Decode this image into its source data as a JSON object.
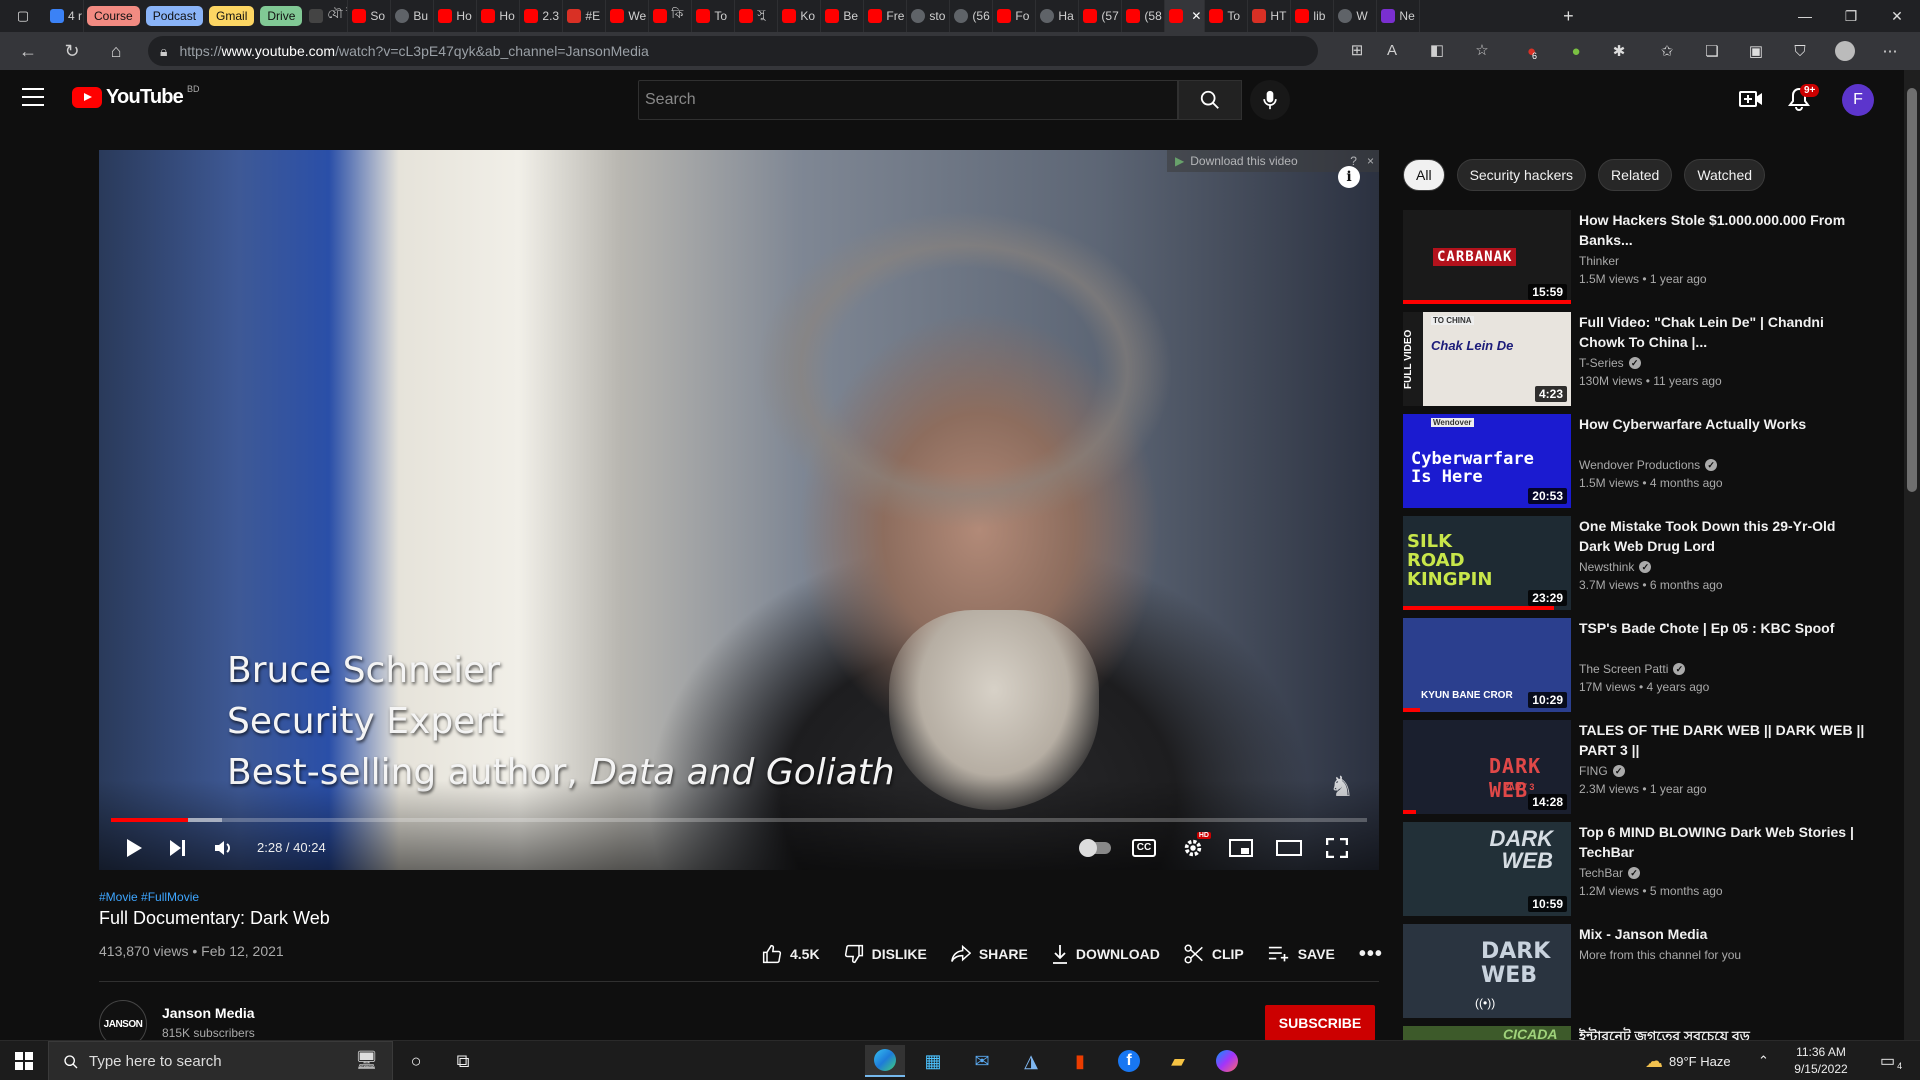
{
  "browser": {
    "tab_groups": [
      {
        "label": "Course",
        "color": "#f28b82"
      },
      {
        "label": "Podcast",
        "color": "#8ab4f8"
      },
      {
        "label": "Gmail",
        "color": "#fdd663"
      },
      {
        "label": "Drive",
        "color": "#81c995"
      }
    ],
    "tabs_before": [
      "4 r"
    ],
    "tabs_after": [
      "যৌ ট",
      "So",
      "Bu",
      "Ho",
      "Ho",
      "2.3",
      "#E",
      "We",
      "কি",
      "To",
      "সু",
      "Ko",
      "Be",
      "Fre",
      "sto",
      "(56",
      "Fo",
      "Ha",
      "(57",
      "(58",
      "",
      "To",
      "HT",
      "lib",
      "W",
      "Ne"
    ],
    "url_prefix": "https://",
    "url_host": "www.youtube.com",
    "url_path": "/watch?v=cL3pE47qyk&ab_channel=JansonMedia",
    "ext_badge_count": "6"
  },
  "header": {
    "logo_text": "YouTube",
    "country_code": "BD",
    "search_placeholder": "Search",
    "notifications_badge": "9+",
    "avatar_letter": "F"
  },
  "player": {
    "download_banner": "Download this video",
    "download_help": "?",
    "download_close": "×",
    "info_label": "i",
    "lower_third": {
      "line1": "Bruce Schneier",
      "line2": "Security Expert",
      "line3_prefix": "Best-selling author, ",
      "line3_italic": "Data and Goliath"
    },
    "time_current": "2:28",
    "time_total": "40:24",
    "time_display": "2:28 / 40:24",
    "progress_fraction": 0.061,
    "hd_badge": "HD",
    "cc_label": "CC"
  },
  "video": {
    "tags": "#Movie #FullMovie",
    "title": "Full Documentary: Dark Web",
    "meta": "413,870 views • Feb 12, 2021",
    "actions": {
      "like": "4.5K",
      "dislike": "DISLIKE",
      "share": "SHARE",
      "download": "DOWNLOAD",
      "clip": "CLIP",
      "save": "SAVE"
    },
    "channel": {
      "avatar_text": "JANSON",
      "name": "Janson Media",
      "subs": "815K subscribers"
    },
    "subscribe": "SUBSCRIBE"
  },
  "chips": [
    "All",
    "Security hackers",
    "Related",
    "Watched"
  ],
  "recommendations": [
    {
      "title": "How Hackers Stole $1.000.000.000 From Banks...",
      "channel": "Thinker",
      "verified": false,
      "views": "1.5M views • 1 year ago",
      "duration": "15:59",
      "watched": 1.0,
      "thumb_text": "CARBANAK",
      "thumb_bg": "#1a1a1a"
    },
    {
      "title": "Full Video: \"Chak Lein De\" | Chandni Chowk To China |...",
      "channel": "T-Series",
      "verified": true,
      "views": "130M views • 11 years ago",
      "duration": "4:23",
      "watched": 0,
      "thumb_text": "Chak Lein De",
      "thumb_bg": "#e8e4de",
      "side_text": "FULL VIDEO",
      "corner_text": "TO CHINA"
    },
    {
      "title": "How Cyberwarfare Actually Works",
      "channel": "Wendover Productions",
      "verified": true,
      "views": "1.5M views • 4 months ago",
      "duration": "20:53",
      "watched": 0,
      "thumb_text": "Cyberwarfare Is Here",
      "thumb_bg": "#1b1bd0",
      "corner_text": "Wendover"
    },
    {
      "title": "One Mistake Took Down this 29-Yr-Old Dark Web Drug Lord",
      "channel": "Newsthink",
      "verified": true,
      "views": "3.7M views • 6 months ago",
      "duration": "23:29",
      "watched": 0.9,
      "thumb_text": "SILK ROAD KINGPIN",
      "thumb_bg": "#1e2a33"
    },
    {
      "title": "TSP's Bade Chote | Ep 05 : KBC Spoof",
      "channel": "The Screen Patti",
      "verified": true,
      "views": "17M views • 4 years ago",
      "duration": "10:29",
      "watched": 0.1,
      "thumb_text": "KYUN BANE CROR",
      "thumb_bg": "#2b3f8e"
    },
    {
      "title": "TALES OF THE DARK WEB || DARK WEB || PART 3 ||",
      "channel": "FING",
      "verified": true,
      "views": "2.3M views • 1 year ago",
      "duration": "14:28",
      "watched": 0.08,
      "thumb_text": "DARK WEB",
      "thumb_bg": "#1a1f2e",
      "corner_text": "PART 3"
    },
    {
      "title": "Top 6 MIND BLOWING Dark Web Stories | TechBar",
      "channel": "TechBar",
      "verified": true,
      "views": "1.2M views • 5 months ago",
      "duration": "10:59",
      "watched": 0,
      "thumb_text": "DARK WEB",
      "thumb_bg": "#223038"
    },
    {
      "title": "Mix - Janson Media",
      "channel": "More from this channel for you",
      "verified": false,
      "views": "",
      "duration": "",
      "watched": 0,
      "thumb_text": "DARK WEB",
      "thumb_bg": "#2a3440",
      "mix": true
    },
    {
      "title": "ইন্টারনেট জগতের সবচেয়ে বড়",
      "channel": "",
      "verified": false,
      "views": "",
      "duration": "",
      "watched": 0,
      "thumb_text": "CICADA",
      "thumb_bg": "#3d5a2a"
    }
  ],
  "taskbar": {
    "search_placeholder": "Type here to search",
    "weather": "89°F  Haze",
    "time": "11:36 AM",
    "date": "9/15/2022",
    "notif_count": "4"
  }
}
